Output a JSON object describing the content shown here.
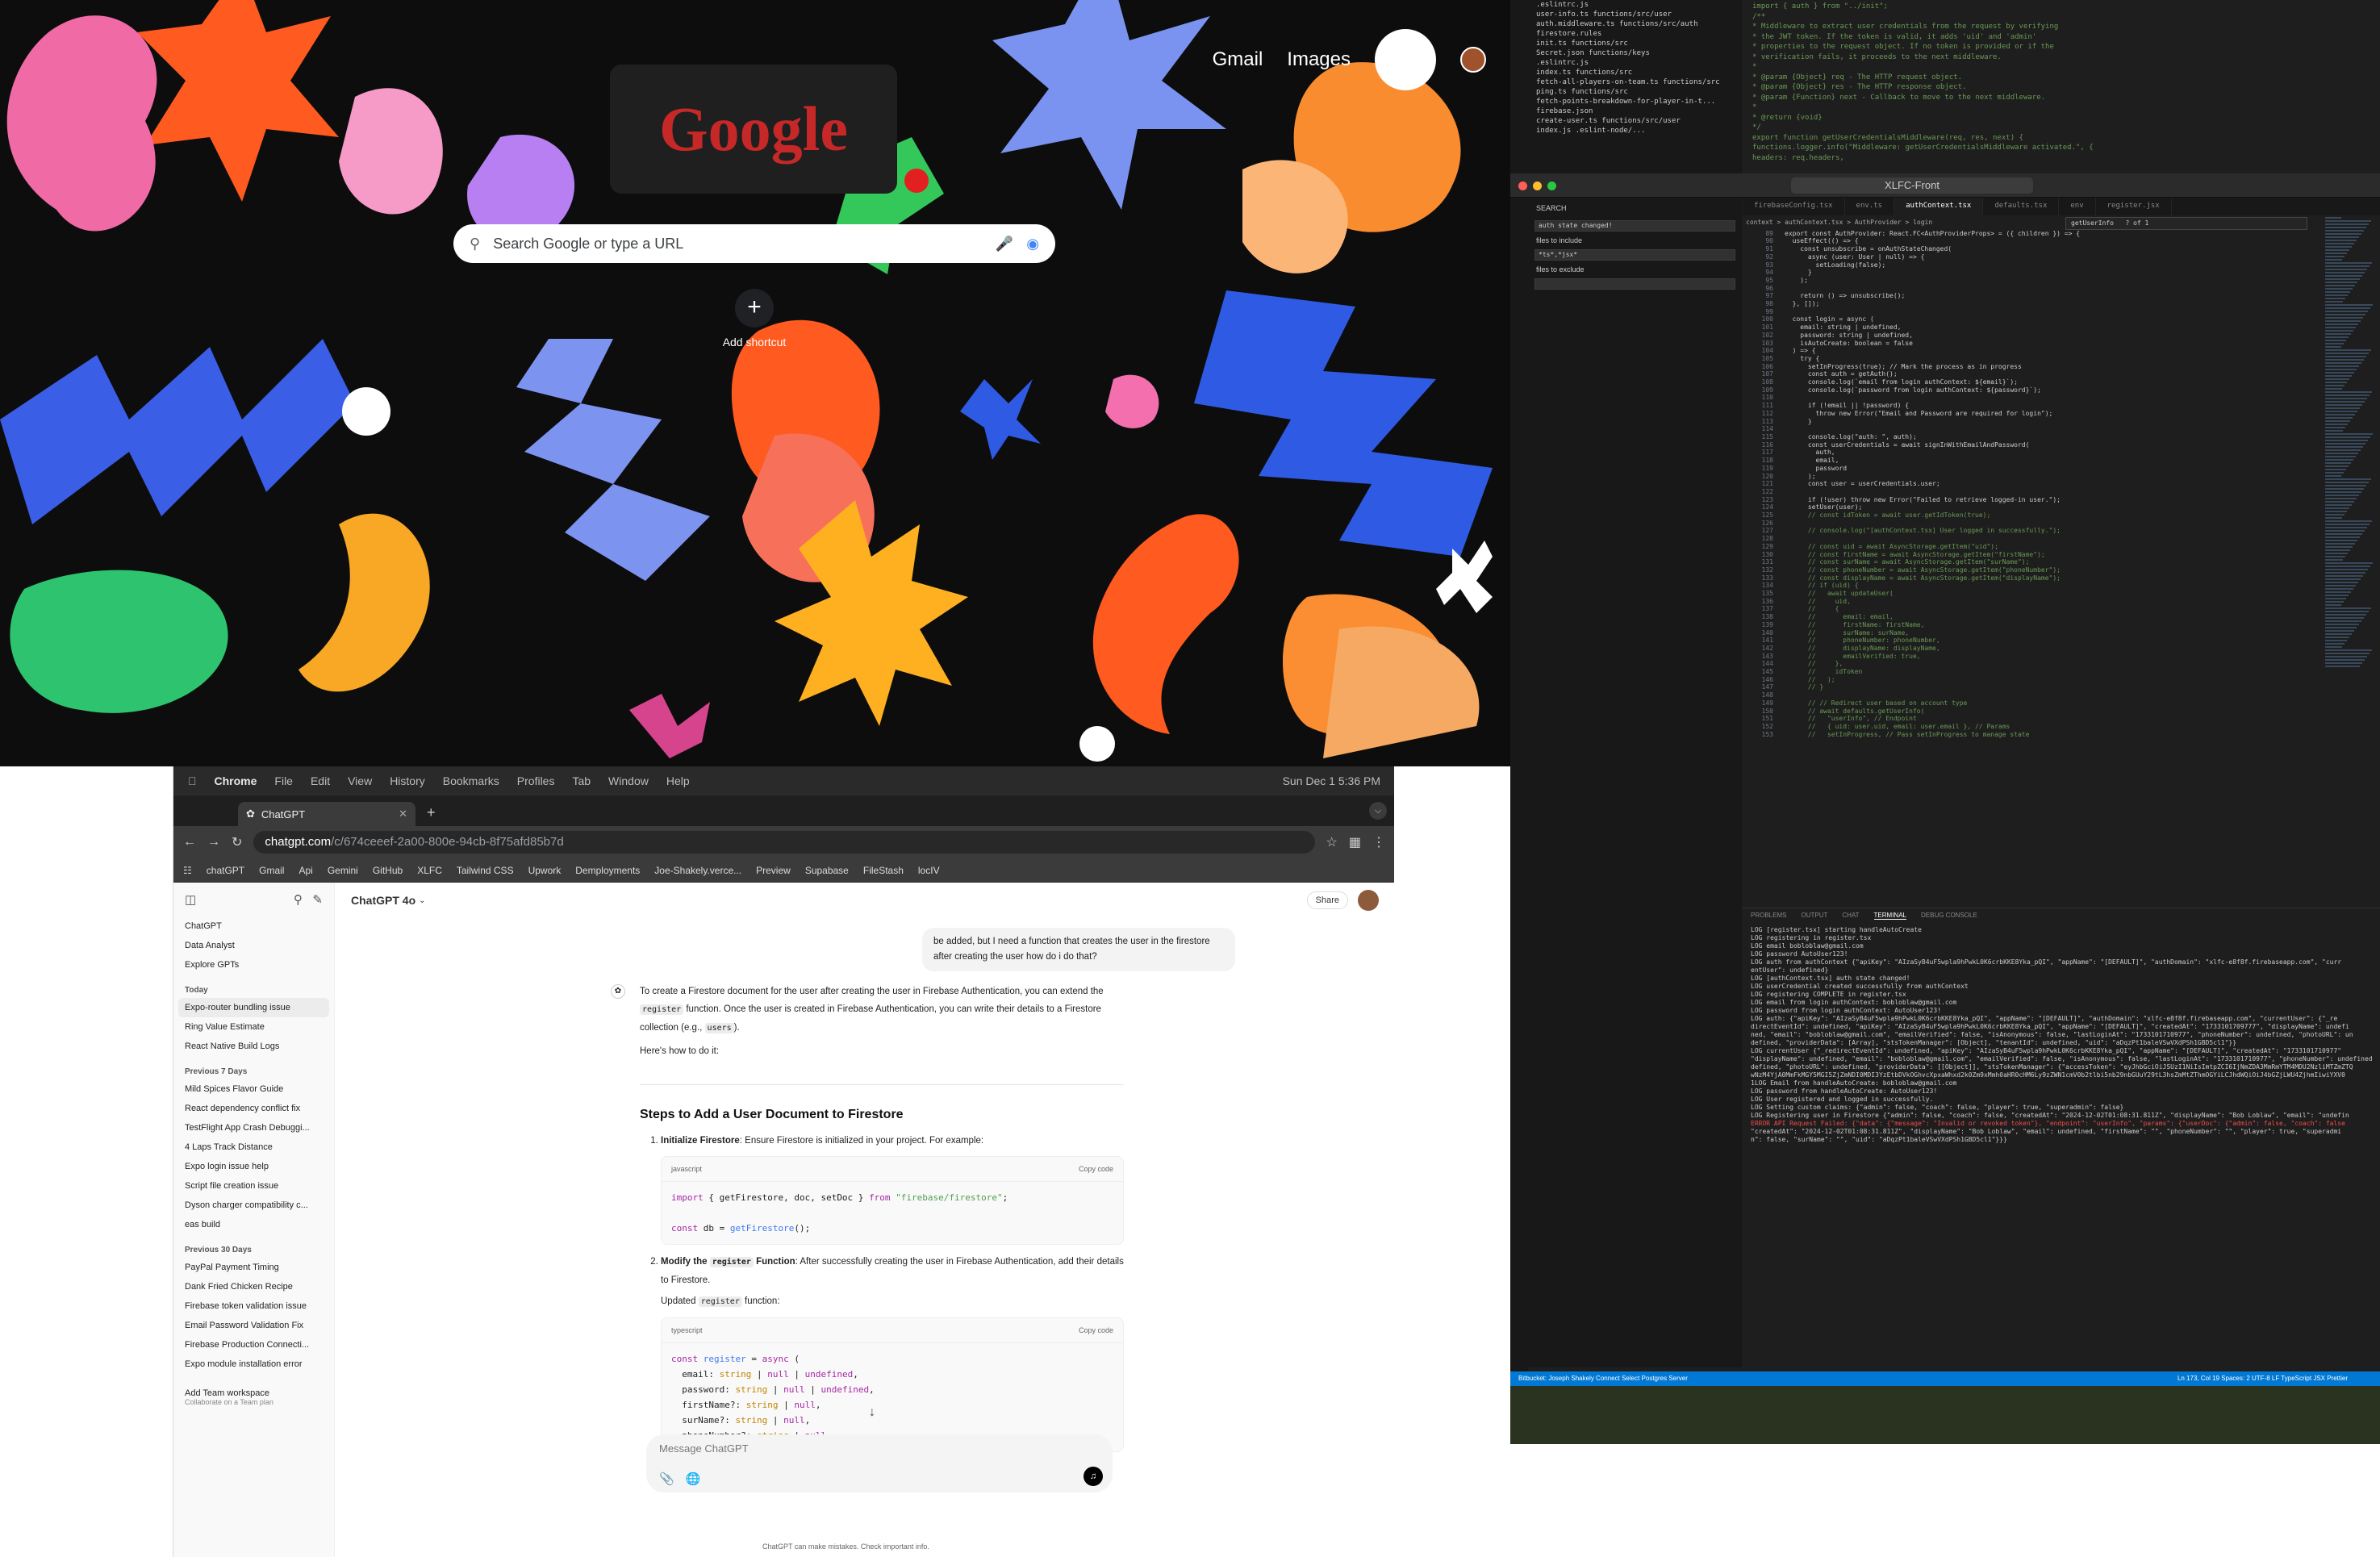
{
  "google": {
    "links": [
      "Gmail",
      "Images"
    ],
    "search_placeholder": "Search Google or type a URL",
    "shortcut_label": "Add shortcut",
    "doodle_text": "Google"
  },
  "vscode": {
    "title": "XLFC-Front",
    "explorer_items": [
      ".eslintrc.js",
      "user-info.ts functions/src/user",
      "auth.middleware.ts functions/src/auth",
      "firestore.rules",
      "init.ts functions/src",
      "Secret.json functions/keys",
      ".eslintrc.js",
      "index.ts functions/src",
      "fetch-all-players-on-team.ts functions/src",
      "ping.ts functions/src",
      "fetch-points-breakdown-for-player-in-t...",
      "firebase.json",
      "create-user.ts functions/src/user",
      "index.js .eslint-node/..."
    ],
    "top_code": [
      "import { auth } from \"../init\";",
      "",
      "/**",
      " * Middleware to extract user credentials from the request by verifying",
      " * the JWT token. If the token is valid, it adds 'uid' and 'admin'",
      " * properties to the request object. If no token is provided or if the",
      " * verification fails, it proceeds to the next middleware.",
      " *",
      " * @param {Object} req - The HTTP request object.",
      " * @param {Object} res - The HTTP response object.",
      " * @param {Function} next - Callback to move to the next middleware.",
      " *",
      " * @return {void}",
      " */",
      "export function getUserCredentialsMiddleware(req, res, next) {",
      "  functions.logger.info(\"Middleware: getUserCredentialsMiddleware activated.\", {",
      "    headers: req.headers,"
    ],
    "search_header": "SEARCH",
    "search_value": "auth state changed!",
    "files_include_label": "files to include",
    "files_include_value": "*ts*,*jsx*",
    "files_exclude_label": "files to exclude",
    "tabs": [
      "firebaseConfig.tsx",
      "env.ts",
      "authContext.tsx",
      "defaults.tsx",
      "env",
      "register.jsx"
    ],
    "breadcrumb": "context > authContext.tsx > AuthProvider > login",
    "find_value": "getUserInfo",
    "find_count": "? of 1",
    "code_lines": [
      {
        "n": "89",
        "t": "export const AuthProvider: React.FC<AuthProviderProps> = ({ children }) => {"
      },
      {
        "n": "90",
        "t": "  useEffect(() => {"
      },
      {
        "n": "91",
        "t": "    const unsubscribe = onAuthStateChanged("
      },
      {
        "n": "92",
        "t": "      async (user: User | null) => {"
      },
      {
        "n": "93",
        "t": "        setLoading(false);"
      },
      {
        "n": "94",
        "t": "      }"
      },
      {
        "n": "95",
        "t": "    );"
      },
      {
        "n": "96",
        "t": ""
      },
      {
        "n": "97",
        "t": "    return () => unsubscribe();"
      },
      {
        "n": "98",
        "t": "  }, []);"
      },
      {
        "n": "99",
        "t": ""
      },
      {
        "n": "100",
        "t": "  const login = async ("
      },
      {
        "n": "101",
        "t": "    email: string | undefined,"
      },
      {
        "n": "102",
        "t": "    password: string | undefined,"
      },
      {
        "n": "103",
        "t": "    isAutoCreate: boolean = false"
      },
      {
        "n": "104",
        "t": "  ) => {"
      },
      {
        "n": "105",
        "t": "    try {"
      },
      {
        "n": "106",
        "t": "      setInProgress(true); // Mark the process as in progress"
      },
      {
        "n": "107",
        "t": "      const auth = getAuth();"
      },
      {
        "n": "108",
        "t": "      console.log(`email from login authContext: ${email}`);"
      },
      {
        "n": "109",
        "t": "      console.log(`password from login authContext: ${password}`);"
      },
      {
        "n": "110",
        "t": ""
      },
      {
        "n": "111",
        "t": "      if (!email || !password) {"
      },
      {
        "n": "112",
        "t": "        throw new Error(\"Email and Password are required for login\");"
      },
      {
        "n": "113",
        "t": "      }"
      },
      {
        "n": "114",
        "t": ""
      },
      {
        "n": "115",
        "t": "      console.log(\"auth: \", auth);"
      },
      {
        "n": "116",
        "t": "      const userCredentials = await signInWithEmailAndPassword("
      },
      {
        "n": "117",
        "t": "        auth,"
      },
      {
        "n": "118",
        "t": "        email,"
      },
      {
        "n": "119",
        "t": "        password"
      },
      {
        "n": "120",
        "t": "      );"
      },
      {
        "n": "121",
        "t": "      const user = userCredentials.user;"
      },
      {
        "n": "122",
        "t": ""
      },
      {
        "n": "123",
        "t": "      if (!user) throw new Error(\"Failed to retrieve logged-in user.\");"
      },
      {
        "n": "124",
        "t": "      setUser(user);"
      },
      {
        "n": "125",
        "t": "      // const idToken = await user.getIdToken(true);"
      },
      {
        "n": "126",
        "t": ""
      },
      {
        "n": "127",
        "t": "      // console.log(\"[authContext.tsx] User logged in successfully.\");"
      },
      {
        "n": "128",
        "t": ""
      },
      {
        "n": "129",
        "t": "      // const uid = await AsyncStorage.getItem(\"uid\");"
      },
      {
        "n": "130",
        "t": "      // const firstName = await AsyncStorage.getItem(\"firstName\");"
      },
      {
        "n": "131",
        "t": "      // const surName = await AsyncStorage.getItem(\"surName\");"
      },
      {
        "n": "132",
        "t": "      // const phoneNumber = await AsyncStorage.getItem(\"phoneNumber\");"
      },
      {
        "n": "133",
        "t": "      // const displayName = await AsyncStorage.getItem(\"displayName\");"
      },
      {
        "n": "134",
        "t": "      // if (uid) {"
      },
      {
        "n": "135",
        "t": "      //   await updateUser("
      },
      {
        "n": "136",
        "t": "      //     uid,"
      },
      {
        "n": "137",
        "t": "      //     {"
      },
      {
        "n": "138",
        "t": "      //       email: email,"
      },
      {
        "n": "139",
        "t": "      //       firstName: firstName,"
      },
      {
        "n": "140",
        "t": "      //       surName: surName,"
      },
      {
        "n": "141",
        "t": "      //       phoneNumber: phoneNumber,"
      },
      {
        "n": "142",
        "t": "      //       displayName: displayName,"
      },
      {
        "n": "143",
        "t": "      //       emailVerified: true,"
      },
      {
        "n": "144",
        "t": "      //     },"
      },
      {
        "n": "145",
        "t": "      //     idToken"
      },
      {
        "n": "146",
        "t": "      //   );"
      },
      {
        "n": "147",
        "t": "      // }"
      },
      {
        "n": "148",
        "t": ""
      },
      {
        "n": "149",
        "t": "      // // Redirect user based on account type"
      },
      {
        "n": "150",
        "t": "      // await defaults.getUserInfo("
      },
      {
        "n": "151",
        "t": "      //   \"userInfo\", // Endpoint"
      },
      {
        "n": "152",
        "t": "      //   { uid: user.uid, email: user.email }, // Params"
      },
      {
        "n": "153",
        "t": "      //   setInProgress, // Pass setInProgress to manage state"
      }
    ],
    "terminal_tabs": [
      "PROBLEMS",
      "OUTPUT",
      "CHAT",
      "TERMINAL",
      "DEBUG CONSOLE"
    ],
    "terminal_lines": [
      "LOG [register.tsx] starting handleAutoCreate",
      "LOG registering in register.tsx",
      "LOG email bobloblaw@gmail.com",
      "LOG password AutoUser123!",
      "LOG auth from authContext {\"apiKey\": \"AIzaSyB4uF5wpla9hPwkL0K6crbKKE8Yka_pQI\", \"appName\": \"[DEFAULT]\", \"authDomain\": \"xlfc-e8f8f.firebaseapp.com\", \"curr",
      "entUser\": undefined}",
      "LOG [authContext.tsx] auth state changed!",
      "LOG userCredential created successfully from authContext",
      "LOG registering COMPLETE in register.tsx",
      "LOG email from login authContext: bobloblaw@gmail.com",
      "LOG password from login authContext: AutoUser123!",
      "LOG auth: {\"apiKey\": \"AIzaSyB4uF5wpla9hPwkL0K6crbKKE8Yka_pQI\", \"appName\": \"[DEFAULT]\", \"authDomain\": \"xlfc-e8f8f.firebaseapp.com\", \"currentUser\": {\"_re",
      "directEventId\": undefined, \"apiKey\": \"AIzaSyB4uF5wpla9hPwkL0K6crbKKE8Yka_pQI\", \"appName\": \"[DEFAULT]\", \"createdAt\": \"1733101709777\", \"displayName\": undefi",
      "ned, \"email\": \"bobloblaw@gmail.com\", \"emailVerified\": false, \"isAnonymous\": false, \"lastLoginAt\": \"1733101710977\", \"phoneNumber\": undefined, \"photoURL\": un",
      "defined, \"providerData\": [Array], \"stsTokenManager\": [Object], \"tenantId\": undefined, \"uid\": \"aDqzPt1baleVSwVXdPSh1GBD5cl1\"}}",
      "LOG currentUser {\"_redirectEventId\": undefined, \"apiKey\": \"AIzaSyB4uF5wpla9hPwkL0K6crbKKE8Yka_pQI\", \"appName\": \"[DEFAULT]\", \"createdAt\": \"1733101710977\"",
      "\"displayName\": undefined, \"email\": \"bobloblaw@gmail.com\", \"emailVerified\": false, \"isAnonymous\": false, \"lastLoginAt\": \"1733101710977\", \"phoneNumber\": undefined,",
      "defined, \"photoURL\": undefined, \"providerData\": [[Object]], \"stsTokenManager\": {\"accessToken\": \"eyJhbGciOiJSUzI1NiIsImtpZCI6IjNmZDA3MmRmYTM4MDU2NzliMTZmZTQ",
      "wNzM4YjA0MmFkMGY5MGI5ZjZmNDI0MDI3YzEtbDVkOGhvcXpxaWhxd2k0Zm9xMmh0aHR0cHM6Ly9zZWN1cmV0b2tlbi5nb29nbGUuY29tL3hsZmMtZThmOGYiLCJhdWQiOiJ4bGZjLWU4ZjhmIiwiYXV0",
      "1LOG Email from handleAutoCreate: bobloblaw@gmail.com",
      "LOG password from handleAutoCreate: AutoUser123!",
      "LOG User registered and logged in successfully.",
      "LOG Setting custom claims: {\"admin\": false, \"coach\": false, \"player\": true, \"superadmin\": false}",
      "LOG Registering user in Firestore {\"admin\": false, \"coach\": false, \"createdAt\": \"2024-12-02T01:08:31.811Z\", \"displayName\": \"Bob Loblaw\", \"email\": \"undefin",
      "ERROR API Request Failed: {\"data\": {\"message\": \"Invalid or revoked token\"}, \"endpoint\": \"userInfo\", \"params\": {\"userDoc\": {\"admin\": false, \"coach\": false",
      "\"createdAt\": \"2024-12-02T01:08:31.811Z\", \"displayName\": \"Bob Loblaw\", \"email\": undefined, \"firstName\": \"\", \"phoneNumber\": \"\", \"player\": true, \"superadmi",
      "n\": false, \"surName\": \"\", \"uid\": \"aDqzPt1baleVSwVXdPSh1GBD5cl1\"}}}"
    ],
    "status_left": "Bitbucket: Joseph Shakely   Connect   Select Postgres Server",
    "status_right": "Ln 173, Col 19   Spaces: 2   UTF-8   LF   TypeScript JSX   Prettier"
  },
  "chrome": {
    "menubar": [
      "Chrome",
      "File",
      "Edit",
      "View",
      "History",
      "Bookmarks",
      "Profiles",
      "Tab",
      "Window",
      "Help"
    ],
    "clock": "Sun Dec 1  5:36 PM",
    "tab_title": "ChatGPT",
    "url_host": "chatgpt.com",
    "url_path": "/c/674ceeef-2a00-800e-94cb-8f75afd85b7d",
    "bookmarks": [
      "chatGPT",
      "Gmail",
      "Api",
      "Gemini",
      "GitHub",
      "XLFC",
      "Tailwind CSS",
      "Upwork",
      "Demployments",
      "Joe-Shakely.verce...",
      "Preview",
      "Supabase",
      "FileStash",
      "locIV"
    ]
  },
  "chatgpt": {
    "side_top": [
      "ChatGPT",
      "Data Analyst",
      "Explore GPTs"
    ],
    "today_label": "Today",
    "today": [
      "Expo-router bundling issue",
      "Ring Value Estimate",
      "React Native Build Logs"
    ],
    "prev7_label": "Previous 7 Days",
    "prev7": [
      "Mild Spices Flavor Guide",
      "React dependency conflict fix",
      "TestFlight App Crash Debuggi...",
      "4 Laps Track Distance",
      "Expo login issue help",
      "Script file creation issue",
      "Dyson charger compatibility c...",
      "eas build"
    ],
    "prev30_label": "Previous 30 Days",
    "prev30": [
      "PayPal Payment Timing",
      "Dank Fried Chicken Recipe",
      "Firebase token validation issue",
      "Email Password Validation Fix",
      "Firebase Production Connecti...",
      "Expo module installation error"
    ],
    "add_workspace": "Add Team workspace",
    "add_workspace_sub": "Collaborate on a Team plan",
    "model": "ChatGPT 4o",
    "share": "Share",
    "user_msg": "be added, but I need a function that creates the user in the firestore after creating the user how do i do that?",
    "answer_p1a": "To create a Firestore document for the user after creating the user in Firebase Authentication, you can extend the ",
    "answer_code1": "register",
    "answer_p1b": " function. Once the user is created in Firebase Authentication, you can write their details to a Firestore collection (e.g., ",
    "answer_code2": "users",
    "answer_p1c": ").",
    "answer_p2": "Here's how to do it:",
    "heading": "Steps to Add a User Document to Firestore",
    "step1_bold": "Initialize Firestore",
    "step1_text": ": Ensure Firestore is initialized in your project. For example:",
    "code1_lang": "javascript",
    "copy": "Copy code",
    "step2_bold": "Modify the ",
    "step2_code": "register",
    "step2_bold2": " Function",
    "step2_text": ": After successfully creating the user in Firebase Authentication, add their details to Firestore.",
    "updated_a": "Updated ",
    "updated_code": "register",
    "updated_b": " function:",
    "code2_lang": "typescript",
    "composer_placeholder": "Message ChatGPT",
    "disclaimer": "ChatGPT can make mistakes. Check important info."
  }
}
